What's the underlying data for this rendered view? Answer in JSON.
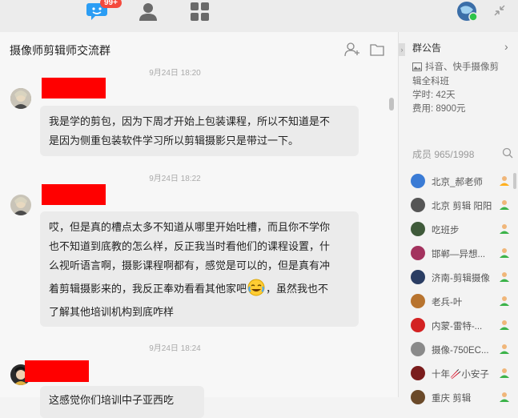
{
  "topbar": {
    "badge": "99+"
  },
  "chat": {
    "title": "摄像师剪辑师交流群",
    "messages": [
      {
        "time": "9月24日 18:20",
        "lines": [
          "我是学的剪包，因为下周才开始上包装课程，所以不知道是不",
          "是因为侧重包装软件学习所以剪辑摄影只是带过一下。"
        ]
      },
      {
        "time": "9月24日 18:22",
        "lines": [
          "哎，但是真的槽点太多不知道从哪里开始吐槽，而且你不学你",
          "也不知道到底教的怎么样，反正我当时看他们的课程设置，什",
          "么视听语言啊，摄影课程啊都有，感觉是可以的，但是真有冲"
        ],
        "line4_before": "着剪辑摄影来的，我反正奉劝看看其他家吧",
        "line4_after": "，虽然我也不",
        "line5": "了解其他培训机构到底咋样"
      },
      {
        "time": "9月24日 18:24",
        "partial": "这感觉你们培训中子亚西吃"
      }
    ]
  },
  "sidebar": {
    "announcement_title": "群公告",
    "announcement_line1": "抖音、快手摄像剪",
    "announcement_line2": "辑全科班",
    "announcement_line3": "学时: 42天",
    "announcement_line4": "费用: 8900元",
    "members_title": "成员 965/1998",
    "members": [
      {
        "name": "北京_郝老师",
        "color": "#3a7bd5"
      },
      {
        "name": "北京 剪辑 阳阳",
        "color": "#555555"
      },
      {
        "name": "吃班步",
        "color": "#3f5a3a"
      },
      {
        "name": "邯郸—异想...",
        "color": "#a3325e"
      },
      {
        "name": "济南-剪辑摄像",
        "color": "#2a3d63"
      },
      {
        "name": "老兵-叶",
        "color": "#b8742f"
      },
      {
        "name": "内蒙-雷特-...",
        "color": "#d32222"
      },
      {
        "name": "摄像-750EC...",
        "color": "#8a8a8a"
      },
      {
        "name": "十年🥢小安子",
        "color": "#7a1c1c"
      },
      {
        "name": "重庆 剪辑",
        "color": "#6b4a2a"
      }
    ]
  }
}
